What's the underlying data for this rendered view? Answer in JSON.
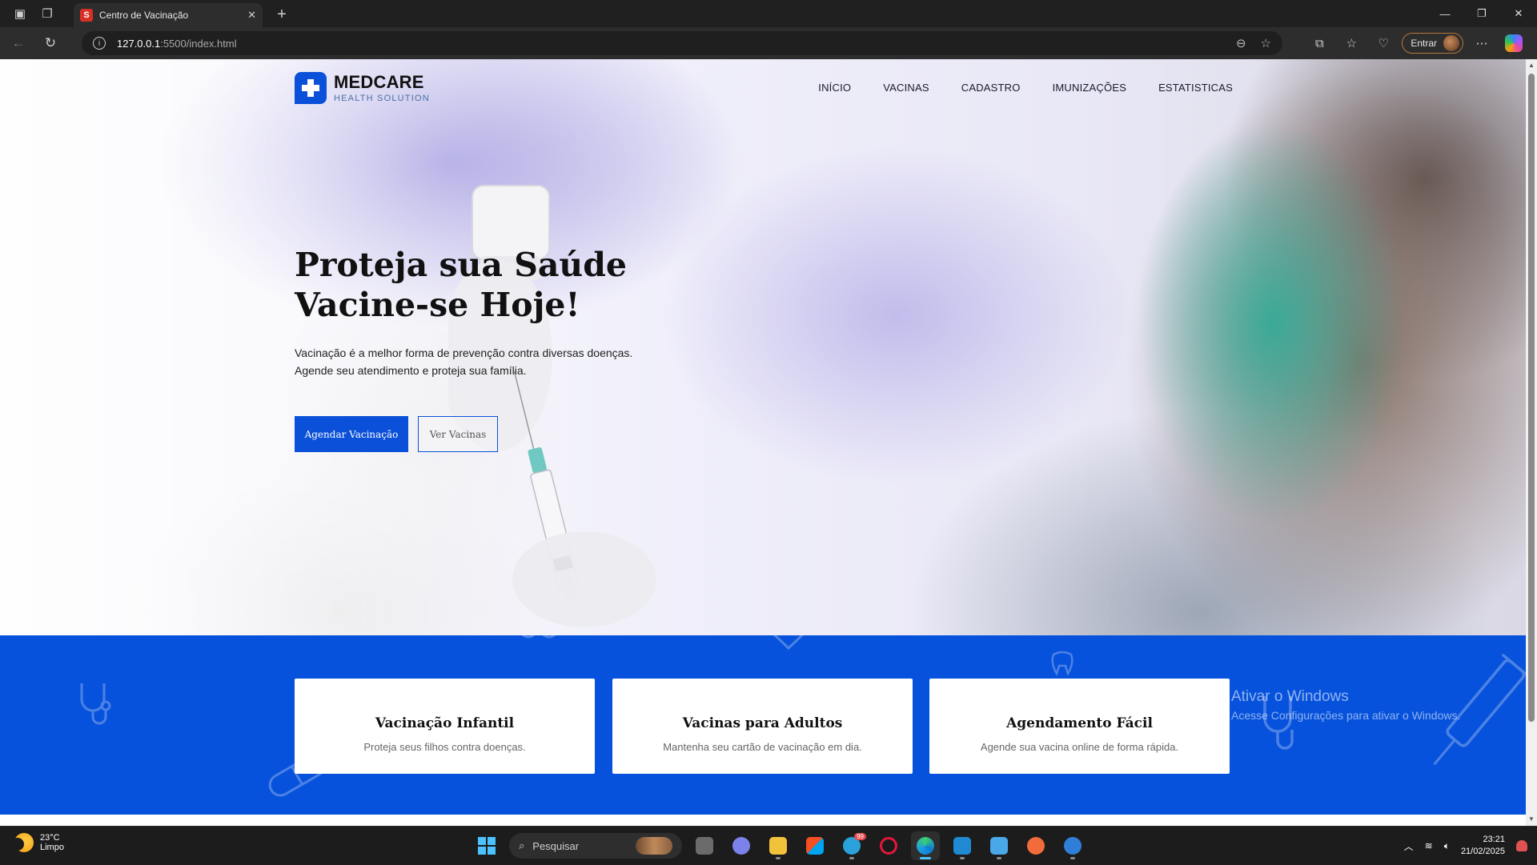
{
  "browser": {
    "tab_title": "Centro de Vacinação",
    "tab_favicon": "S",
    "url_host": "127.0.0.1",
    "url_rest": ":5500/index.html",
    "signin_label": "Entrar"
  },
  "site": {
    "brand": "MEDCARE",
    "tagline": "HEALTH SOLUTION",
    "nav": [
      "INÍCIO",
      "VACINAS",
      "CADASTRO",
      "IMUNIZAÇÕES",
      "ESTATISTICAS"
    ],
    "hero_title_line1": "Proteja sua Saúde",
    "hero_title_line2": "Vacine-se Hoje!",
    "hero_text_line1": "Vacinação é a melhor forma de prevenção contra diversas doenças.",
    "hero_text_line2": "Agende seu atendimento e proteja sua família.",
    "cta_primary": "Agendar Vacinação",
    "cta_secondary": "Ver Vacinas",
    "accent": "#0752dc",
    "cards": [
      {
        "title": "Vacinação Infantil",
        "text": "Proteja seus filhos contra doenças."
      },
      {
        "title": "Vacinas para Adultos",
        "text": "Mantenha seu cartão de vacinação em dia."
      },
      {
        "title": "Agendamento Fácil",
        "text": "Agende sua vacina online de forma rápida."
      }
    ]
  },
  "watermark": {
    "line1": "Ativar o Windows",
    "line2": "Acesse Configurações para ativar o Windows."
  },
  "taskbar": {
    "temperature": "23°C",
    "weather": "Limpo",
    "search_placeholder": "Pesquisar",
    "time": "23:21",
    "date": "21/02/2025",
    "telegram_badge": "99"
  }
}
